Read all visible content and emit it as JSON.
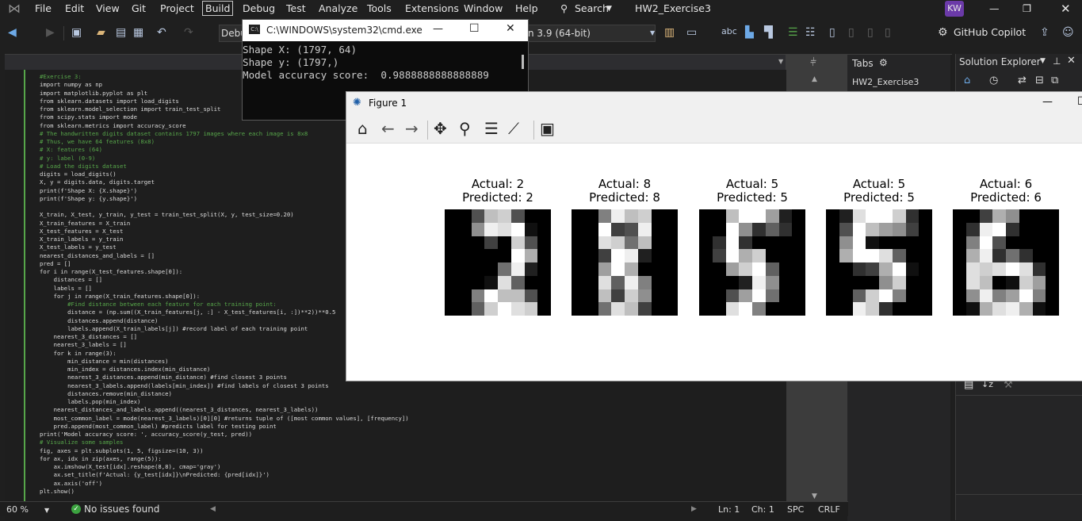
{
  "menubar": {
    "items": [
      "File",
      "Edit",
      "View",
      "Git",
      "Project",
      "Build",
      "Debug",
      "Test",
      "Analyze",
      "Tools",
      "Extensions",
      "Window",
      "Help"
    ],
    "search_label": "Search",
    "solution_name": "HW2_Exercise3",
    "user_initials": "KW"
  },
  "toolbar": {
    "config": "Debu",
    "env": "n 3.9 (64-bit)",
    "copilot": "GitHub Copilot"
  },
  "tabs_panel": {
    "title": "Tabs",
    "tab": "HW2_Exercise3"
  },
  "solution_explorer": {
    "title": "Solution Explorer"
  },
  "cmd": {
    "title": "C:\\WINDOWS\\system32\\cmd.exe",
    "lines": [
      "Shape X: (1797, 64)",
      "Shape y: (1797,)",
      "Model accuracy score:  0.9888888888888889"
    ]
  },
  "figure": {
    "title": "Figure 1",
    "subplots": [
      {
        "actual": "Actual: 2",
        "predicted": "Predicted: 2",
        "pixels": [
          0,
          0,
          5,
          12,
          13,
          5,
          0,
          0,
          0,
          0,
          9,
          15,
          14,
          16,
          1,
          0,
          0,
          0,
          0,
          4,
          0,
          13,
          5,
          0,
          0,
          0,
          0,
          0,
          0,
          16,
          11,
          0,
          0,
          0,
          0,
          0,
          7,
          15,
          2,
          0,
          0,
          0,
          0,
          1,
          14,
          6,
          0,
          0,
          0,
          0,
          8,
          16,
          12,
          12,
          5,
          0,
          0,
          0,
          6,
          13,
          16,
          14,
          13,
          0
        ]
      },
      {
        "actual": "Actual: 8",
        "predicted": "Predicted: 8",
        "pixels": [
          0,
          0,
          8,
          15,
          12,
          13,
          0,
          0,
          0,
          0,
          16,
          4,
          5,
          15,
          0,
          0,
          0,
          0,
          14,
          13,
          7,
          12,
          0,
          0,
          0,
          0,
          4,
          16,
          15,
          2,
          0,
          0,
          0,
          0,
          10,
          16,
          11,
          0,
          0,
          0,
          0,
          0,
          14,
          6,
          15,
          8,
          0,
          0,
          0,
          0,
          12,
          4,
          13,
          9,
          0,
          0,
          0,
          0,
          7,
          14,
          12,
          4,
          0,
          0
        ]
      },
      {
        "actual": "Actual: 5",
        "predicted": "Predicted: 5",
        "pixels": [
          0,
          0,
          12,
          16,
          16,
          10,
          2,
          0,
          0,
          0,
          16,
          9,
          3,
          6,
          3,
          0,
          0,
          3,
          16,
          3,
          0,
          0,
          0,
          0,
          0,
          4,
          16,
          11,
          13,
          0,
          0,
          0,
          0,
          0,
          10,
          13,
          16,
          6,
          0,
          0,
          0,
          0,
          0,
          2,
          15,
          9,
          0,
          0,
          0,
          0,
          5,
          10,
          16,
          7,
          0,
          0,
          0,
          0,
          14,
          16,
          8,
          0,
          0,
          0
        ]
      },
      {
        "actual": "Actual: 5",
        "predicted": "Predicted: 5",
        "pixels": [
          0,
          2,
          14,
          16,
          16,
          13,
          3,
          0,
          0,
          5,
          16,
          12,
          10,
          9,
          4,
          0,
          0,
          9,
          16,
          1,
          0,
          0,
          0,
          0,
          0,
          11,
          16,
          16,
          14,
          6,
          0,
          0,
          0,
          0,
          3,
          4,
          11,
          16,
          1,
          0,
          0,
          0,
          0,
          0,
          9,
          13,
          0,
          0,
          0,
          0,
          6,
          13,
          16,
          8,
          0,
          0,
          0,
          0,
          15,
          13,
          3,
          0,
          0,
          0
        ]
      },
      {
        "actual": "Actual: 6",
        "predicted": "Predicted: 6",
        "pixels": [
          0,
          0,
          4,
          11,
          9,
          0,
          0,
          0,
          0,
          3,
          15,
          16,
          3,
          0,
          0,
          0,
          0,
          8,
          16,
          5,
          0,
          0,
          0,
          0,
          0,
          11,
          15,
          3,
          7,
          3,
          0,
          0,
          0,
          14,
          13,
          14,
          16,
          14,
          3,
          0,
          0,
          14,
          12,
          0,
          1,
          13,
          10,
          0,
          0,
          9,
          15,
          8,
          10,
          16,
          8,
          0,
          0,
          1,
          11,
          14,
          15,
          11,
          1,
          0
        ]
      }
    ]
  },
  "status": {
    "zoom": "60 %",
    "issues": "No issues found",
    "ln": "Ln: 1",
    "ch": "Ch: 1",
    "spc": "SPC",
    "crlf": "CRLF"
  },
  "code": [
    "#Exercise 3:",
    "import numpy as np",
    "import matplotlib.pyplot as plt",
    "from sklearn.datasets import load_digits",
    "from sklearn.model_selection import train_test_split",
    "from scipy.stats import mode",
    "from sklearn.metrics import accuracy_score",
    "# The handwritten digits dataset contains 1797 images where each image is 8x8",
    "# Thus, we have 64 features (8x8)",
    "# X: features (64)",
    "# y: label (0-9)",
    "# Load the digits dataset",
    "digits = load_digits()",
    "X, y = digits.data, digits.target",
    "print(f'Shape X: {X.shape}')",
    "print(f'Shape y: {y.shape}')",
    "",
    "X_train, X_test, y_train, y_test = train_test_split(X, y, test_size=0.20)",
    "X_train_features = X_train",
    "X_test_features = X_test",
    "X_train_labels = y_train",
    "X_test_labels = y_test",
    "nearest_distances_and_labels = []",
    "pred = []",
    "for i in range(X_test_features.shape[0]):",
    "    distances = []",
    "    labels = []",
    "    for j in range(X_train_features.shape[0]):",
    "        #Find distance between each feature for each training point:",
    "        distance = (np.sum((X_train_features[j, :] - X_test_features[i, :])**2))**0.5",
    "        distances.append(distance)",
    "        labels.append(X_train_labels[j]) #record label of each training point",
    "    nearest_3_distances = []",
    "    nearest_3_labels = []",
    "    for k in range(3):",
    "        min_distance = min(distances)",
    "        min_index = distances.index(min_distance)",
    "        nearest_3_distances.append(min_distance) #find closest 3 points",
    "        nearest_3_labels.append(labels[min_index]) #find labels of closest 3 points",
    "        distances.remove(min_distance)",
    "        labels.pop(min_index)",
    "    nearest_distances_and_labels.append((nearest_3_distances, nearest_3_labels))",
    "    most_common_label = mode(nearest_3_labels)[0][0] #returns tuple of ([most common values], [frequency])",
    "    pred.append(most_common_label) #predicts label for testing point",
    "print('Model accuracy score: ', accuracy_score(y_test, pred))",
    "# Visualize some samples",
    "fig, axes = plt.subplots(1, 5, figsize=(10, 3))",
    "for ax, idx in zip(axes, range(5)):",
    "    ax.imshow(X_test[idx].reshape(8,8), cmap='gray')",
    "    ax.set_title(f'Actual: {y_test[idx]}\\nPredicted: {pred[idx]}')",
    "    ax.axis('off')",
    "plt.show()"
  ]
}
